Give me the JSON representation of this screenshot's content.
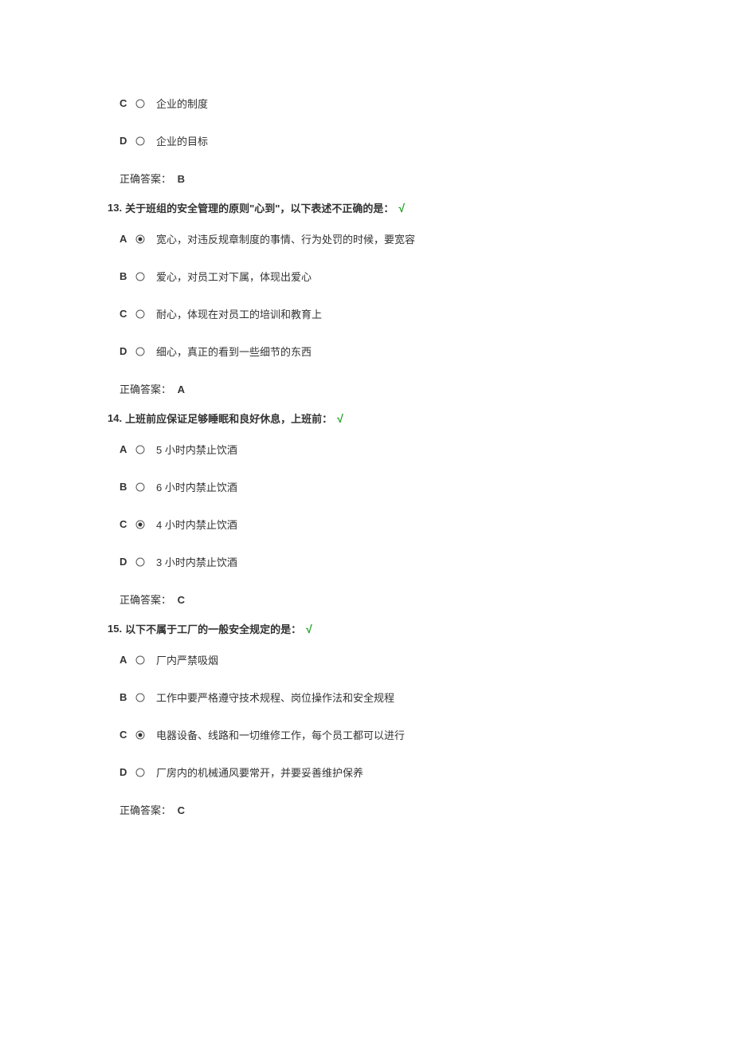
{
  "q12_continuation": {
    "options": [
      {
        "letter": "C",
        "text": "企业的制度",
        "selected": false
      },
      {
        "letter": "D",
        "text": "企业的目标",
        "selected": false
      }
    ],
    "answer_label": "正确答案：",
    "answer_value": "B"
  },
  "questions": [
    {
      "number": "13.",
      "text": "关于班组的安全管理的原则\"心到\"，以下表述不正确的是：",
      "correct_mark": "√",
      "options": [
        {
          "letter": "A",
          "text": "宽心，对违反规章制度的事情、行为处罚的时候，要宽容",
          "selected": true
        },
        {
          "letter": "B",
          "text": "爱心，对员工对下属，体现出爱心",
          "selected": false
        },
        {
          "letter": "C",
          "text": "耐心，体现在对员工的培训和教育上",
          "selected": false
        },
        {
          "letter": "D",
          "text": "细心，真正的看到一些细节的东西",
          "selected": false
        }
      ],
      "answer_label": "正确答案：",
      "answer_value": "A"
    },
    {
      "number": "14.",
      "text": "上班前应保证足够睡眠和良好休息，上班前：",
      "correct_mark": "√",
      "options": [
        {
          "letter": "A",
          "text": "5 小时内禁止饮酒",
          "selected": false
        },
        {
          "letter": "B",
          "text": "6 小时内禁止饮酒",
          "selected": false
        },
        {
          "letter": "C",
          "text": "4 小时内禁止饮酒",
          "selected": true
        },
        {
          "letter": "D",
          "text": "3 小时内禁止饮酒",
          "selected": false
        }
      ],
      "answer_label": "正确答案：",
      "answer_value": "C"
    },
    {
      "number": "15.",
      "text": "以下不属于工厂的一般安全规定的是：",
      "correct_mark": "√",
      "options": [
        {
          "letter": "A",
          "text": "厂内严禁吸烟",
          "selected": false
        },
        {
          "letter": "B",
          "text": "工作中要严格遵守技术规程、岗位操作法和安全规程",
          "selected": false
        },
        {
          "letter": "C",
          "text": "电器设备、线路和一切维修工作，每个员工都可以进行",
          "selected": true
        },
        {
          "letter": "D",
          "text": "厂房内的机械通风要常开，并要妥善维护保养",
          "selected": false
        }
      ],
      "answer_label": "正确答案：",
      "answer_value": "C"
    }
  ]
}
